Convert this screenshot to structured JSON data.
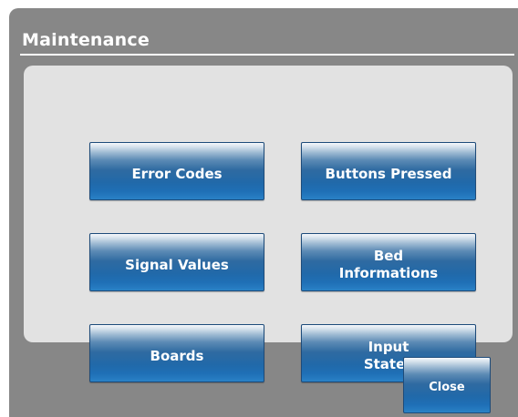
{
  "dialog": {
    "title": "Maintenance",
    "background_color": "#878787",
    "panel_color": "#e2e2e2"
  },
  "buttons": [
    {
      "label": "Error Codes"
    },
    {
      "label": "Buttons Pressed"
    },
    {
      "label": "Signal Values"
    },
    {
      "label": "Bed\nInformations"
    },
    {
      "label": "Boards"
    },
    {
      "label": "Input\nStates"
    }
  ],
  "footer": {
    "close_label": "Close"
  },
  "colors": {
    "button_top": "#f5f8fb",
    "button_bottom": "#1f6fb6",
    "button_text": "#ffffff"
  }
}
